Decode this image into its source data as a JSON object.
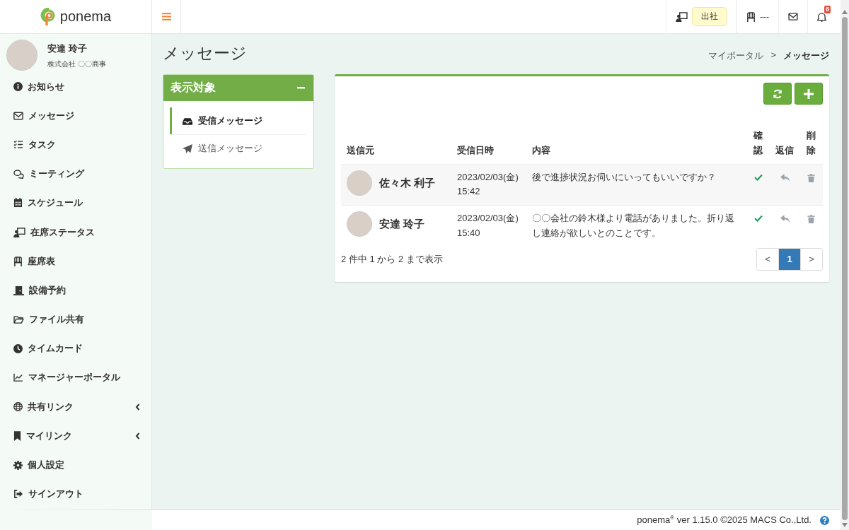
{
  "logo": {
    "text": "ponema"
  },
  "topbar": {
    "attendance_status": "出社",
    "seat": "---",
    "notification_count": "8"
  },
  "user": {
    "name": "安達 玲子",
    "company": "株式会社 〇〇商事"
  },
  "sidebar": {
    "items": [
      {
        "label": "お知らせ",
        "kind": "link"
      },
      {
        "label": "メッセージ",
        "kind": "link"
      },
      {
        "label": "タスク",
        "kind": "link"
      },
      {
        "label": "ミーティング",
        "kind": "link"
      },
      {
        "label": "スケジュール",
        "kind": "link"
      },
      {
        "label": "在席ステータス",
        "kind": "link"
      },
      {
        "label": "座席表",
        "kind": "link"
      },
      {
        "label": "設備予約",
        "kind": "link"
      },
      {
        "label": "ファイル共有",
        "kind": "link"
      },
      {
        "label": "タイムカード",
        "kind": "link"
      },
      {
        "label": "マネージャーポータル",
        "kind": "link"
      },
      {
        "label": "共有リンク",
        "kind": "group"
      },
      {
        "label": "マイリンク",
        "kind": "group"
      },
      {
        "label": "個人設定",
        "kind": "link"
      },
      {
        "label": "サインアウト",
        "kind": "link"
      }
    ]
  },
  "page": {
    "title": "メッセージ",
    "breadcrumb": [
      {
        "label": "マイポータル",
        "current": false
      },
      {
        "label": "メッセージ",
        "current": true
      }
    ],
    "breadcrumb_separator": ">"
  },
  "filter_panel": {
    "title": "表示対象",
    "items": [
      {
        "label": "受信メッセージ",
        "selected": true
      },
      {
        "label": "送信メッセージ",
        "selected": false
      }
    ]
  },
  "messages": {
    "columns": [
      "送信元",
      "受信日時",
      "内容",
      "確認",
      "返信",
      "削除"
    ],
    "rows": [
      {
        "sender": "佐々木 利子",
        "date": "2023/02/03(金)",
        "time": "15:42",
        "content": "後で進捗状況お伺いにいってもいいですか？",
        "confirmed": true
      },
      {
        "sender": "安達 玲子",
        "date": "2023/02/03(金)",
        "time": "15:40",
        "content": "〇〇会社の鈴木様より電話がありました。折り返し連絡が欲しいとのことです。",
        "confirmed": true
      }
    ],
    "summary": "2 件中 1 から 2 まで表示",
    "pagination": [
      {
        "label": "<",
        "selected": false
      },
      {
        "label": "1",
        "selected": true
      },
      {
        "label": ">",
        "selected": false
      }
    ]
  },
  "footer": {
    "text": "ponema$^{®}$ ver 1.15.0 ©2025 MACS Co.,Ltd."
  }
}
